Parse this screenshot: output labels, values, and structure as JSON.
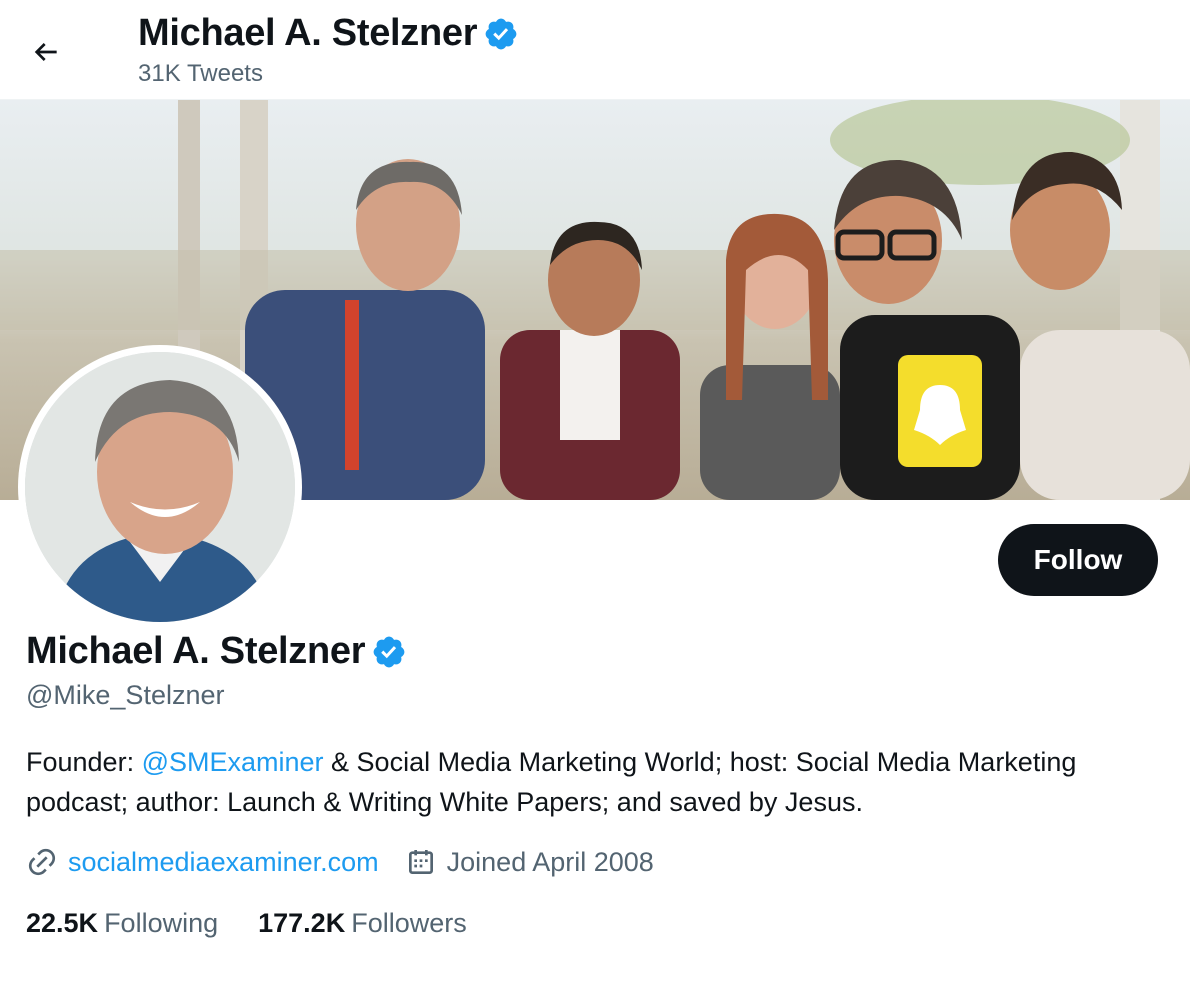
{
  "header": {
    "name": "Michael A. Stelzner",
    "tweets": "31K Tweets"
  },
  "profile": {
    "name": "Michael A. Stelzner",
    "handle": "@Mike_Stelzner",
    "follow_label": "Follow",
    "bio": {
      "prefix": "Founder: ",
      "mention": "@SMExaminer",
      "rest": " & Social Media Marketing World; host: Social Media Marketing podcast; author: Launch & Writing White Papers; and saved by Jesus."
    },
    "website": "socialmediaexaminer.com",
    "joined": "Joined April 2008",
    "following": {
      "count": "22.5K",
      "label": "Following"
    },
    "followers": {
      "count": "177.2K",
      "label": "Followers"
    }
  },
  "colors": {
    "accent": "#1d9bf0",
    "text": "#0f1419",
    "secondary": "#536471",
    "verified": "#1d9bf0"
  },
  "icons": {
    "back": "arrow-left-icon",
    "verified": "verified-badge-icon",
    "link": "link-icon",
    "calendar": "calendar-icon"
  }
}
